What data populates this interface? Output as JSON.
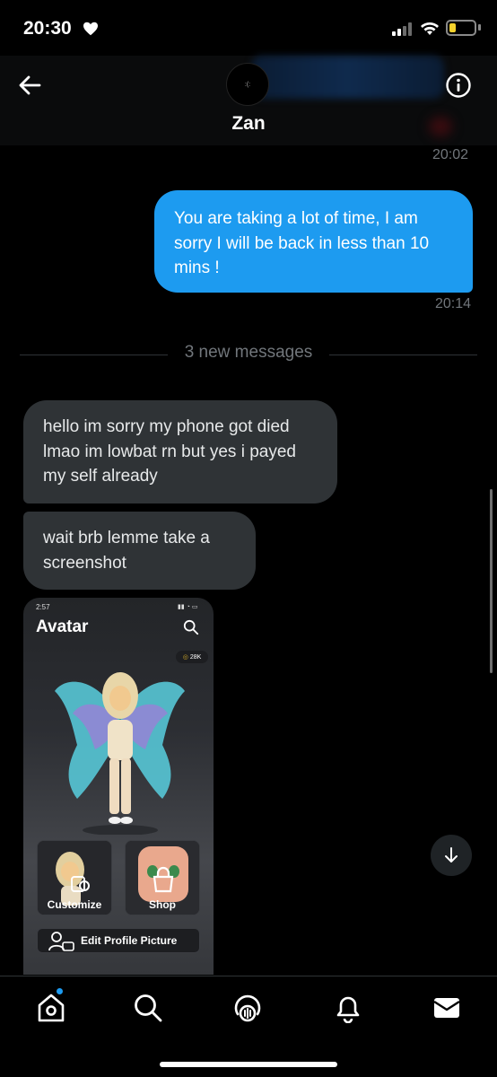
{
  "status_bar": {
    "time": "20:30"
  },
  "header": {
    "contact_name": "Zan",
    "avatar_text": ":(:"
  },
  "timestamps": {
    "before": "20:02",
    "sent": "20:14"
  },
  "outgoing_message": {
    "text": "You are taking a lot of time, I am sorry I will be back in less than 10 mins !"
  },
  "divider": {
    "label": "3 new messages"
  },
  "incoming_messages": [
    {
      "text": "hello im sorry my phone got died lmao im lowbat rn but yes i payed my self already"
    },
    {
      "text": "wait brb lemme take a screenshot"
    }
  ],
  "attachment": {
    "time": "2:57",
    "title": "Avatar",
    "robux": "28K",
    "tiles": [
      {
        "label": "Customize"
      },
      {
        "label": "Shop"
      }
    ],
    "edit_label": "Edit Profile Picture"
  },
  "bottom_nav": {
    "items": [
      "home-icon",
      "search-icon",
      "spaces-icon",
      "notifications-icon",
      "messages-icon"
    ]
  },
  "colors": {
    "accent": "#1d9bf0",
    "incoming_bubble": "#2f3336",
    "background": "#000000"
  }
}
